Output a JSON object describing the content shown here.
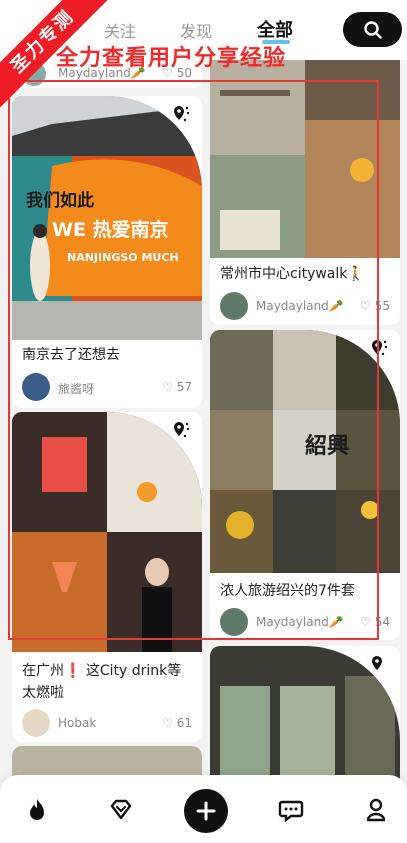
{
  "nav": {
    "tabs": [
      {
        "label": "关注"
      },
      {
        "label": "发现"
      },
      {
        "label": "全部",
        "active": true
      }
    ],
    "search_icon": "search-icon"
  },
  "overlay": {
    "ribbon": "圣力专测",
    "headline": "全力查看用户分享经验",
    "box_color": "#e53935"
  },
  "feed": {
    "top_partial": {
      "author": "Maydayland🥕",
      "likes": "50"
    },
    "cards": [
      {
        "title": "南京去了还想去",
        "author": "旅酱呀",
        "likes": "57",
        "mural_text_1": "我们如此",
        "mural_text_2": "WE 热爱南京",
        "mural_text_3": "NANJINGSO MUCH"
      },
      {
        "title": "常州市中心citywalk🚶",
        "author": "Maydayland🥕",
        "likes": "55"
      },
      {
        "title": "在广州❗ 这City drink等太燃啦",
        "author": "Hobak",
        "likes": "61"
      },
      {
        "title": "浓人旅游绍兴的7件套",
        "author": "Maydayland🥕",
        "likes": "54",
        "sign_text": "紹興"
      }
    ]
  },
  "bottom_nav": [
    "fire-icon",
    "diamond-icon",
    "plus-icon",
    "chat-icon",
    "profile-icon"
  ],
  "colors": {
    "accent": "#ee1c25",
    "dark": "#111111",
    "tab_underline": "#3fb5e0"
  }
}
